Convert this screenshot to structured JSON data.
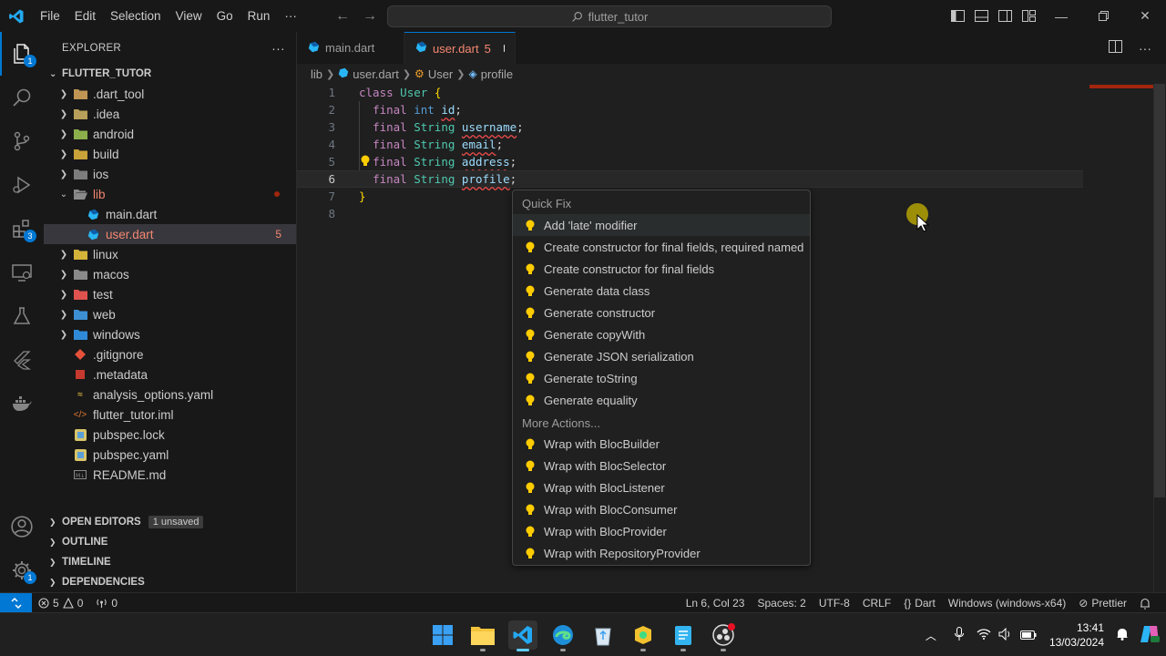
{
  "titlebar": {
    "menu": [
      "File",
      "Edit",
      "Selection",
      "View",
      "Go",
      "Run",
      "···"
    ],
    "search": "flutter_tutor"
  },
  "activity_bar": {
    "explorer_badge": "1",
    "extensions_badge": "3",
    "settings_badge": "1"
  },
  "sidebar": {
    "title": "EXPLORER",
    "more": "···",
    "project": "FLUTTER_TUTOR",
    "tree": [
      {
        "name": ".dart_tool",
        "type": "folder"
      },
      {
        "name": ".idea",
        "type": "folder"
      },
      {
        "name": "android",
        "type": "folder"
      },
      {
        "name": "build",
        "type": "folder"
      },
      {
        "name": "ios",
        "type": "folder"
      },
      {
        "name": "lib",
        "type": "folder-open"
      },
      {
        "name": "main.dart",
        "type": "dart"
      },
      {
        "name": "user.dart",
        "type": "dart",
        "problems": "5"
      },
      {
        "name": "linux",
        "type": "folder"
      },
      {
        "name": "macos",
        "type": "folder"
      },
      {
        "name": "test",
        "type": "folder"
      },
      {
        "name": "web",
        "type": "folder"
      },
      {
        "name": "windows",
        "type": "folder"
      },
      {
        "name": ".gitignore",
        "type": "file"
      },
      {
        "name": ".metadata",
        "type": "file"
      },
      {
        "name": "analysis_options.yaml",
        "type": "file"
      },
      {
        "name": "flutter_tutor.iml",
        "type": "file"
      },
      {
        "name": "pubspec.lock",
        "type": "file"
      },
      {
        "name": "pubspec.yaml",
        "type": "file"
      },
      {
        "name": "README.md",
        "type": "file"
      }
    ],
    "sections": {
      "open_editors": "OPEN EDITORS",
      "unsaved": "1 unsaved",
      "outline": "OUTLINE",
      "timeline": "TIMELINE",
      "dependencies": "DEPENDENCIES"
    }
  },
  "tabs": [
    {
      "label": "main.dart"
    },
    {
      "label": "user.dart",
      "problems": "5"
    }
  ],
  "breadcrumb": [
    "lib",
    "user.dart",
    "User",
    "profile"
  ],
  "editor": {
    "line_numbers": [
      "1",
      "2",
      "3",
      "4",
      "5",
      "6",
      "7",
      "8"
    ],
    "current_line": 6
  },
  "quick_fix": {
    "title": "Quick Fix",
    "items": [
      "Add 'late' modifier",
      "Create constructor for final fields, required named",
      "Create constructor for final fields",
      "Generate data class",
      "Generate constructor",
      "Generate copyWith",
      "Generate JSON serialization",
      "Generate toString",
      "Generate equality"
    ],
    "more_title": "More Actions...",
    "more_items": [
      "Wrap with BlocBuilder",
      "Wrap with BlocSelector",
      "Wrap with BlocListener",
      "Wrap with BlocConsumer",
      "Wrap with BlocProvider",
      "Wrap with RepositoryProvider"
    ]
  },
  "status_bar": {
    "errors": "5",
    "warnings": "0",
    "ports": "0",
    "position": "Ln 6, Col 23",
    "spaces": "Spaces: 2",
    "encoding": "UTF-8",
    "eol": "CRLF",
    "language_braces": "{}",
    "language": "Dart",
    "device": "Windows (windows-x64)",
    "prettier": "Prettier"
  },
  "taskbar": {
    "time": "13:41",
    "date": "13/03/2024"
  },
  "colors": {
    "accent": "#0078d4",
    "error": "#f48771",
    "bulb": "#ffcc00"
  }
}
